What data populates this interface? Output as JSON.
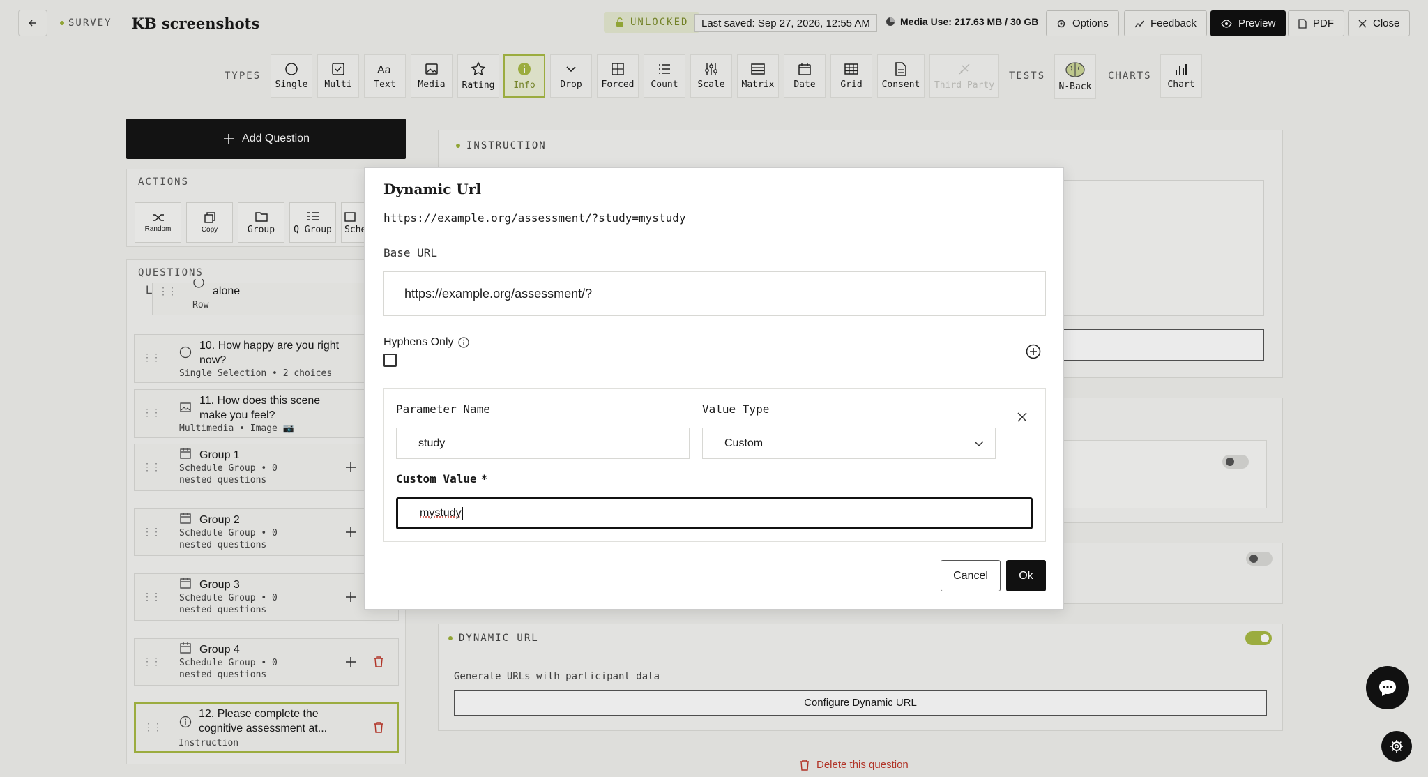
{
  "header": {
    "survey_tag": "SURVEY",
    "title": "KB screenshots",
    "unlocked": "UNLOCKED",
    "last_saved": "Last saved: Sep 27, 2026, 12:55 AM",
    "media_use": "Media Use: 217.63 MB / 30 GB",
    "options": "Options",
    "feedback": "Feedback",
    "preview": "Preview",
    "pdf": "PDF",
    "close": "Close"
  },
  "toolbar": {
    "types_label": "TYPES",
    "tests_label": "TESTS",
    "charts_label": "CHARTS",
    "types": [
      "Single",
      "Multi",
      "Text",
      "Media",
      "Rating",
      "Info",
      "Drop",
      "Forced",
      "Count",
      "Scale",
      "Matrix",
      "Date",
      "Grid",
      "Consent",
      "Third Party"
    ],
    "tests": [
      "N-Back"
    ],
    "charts": [
      "Chart"
    ]
  },
  "left": {
    "add_question": "Add Question",
    "actions_label": "ACTIONS",
    "actions": [
      "Random",
      "Copy",
      "Group",
      "Q Group",
      "Sche"
    ],
    "questions_label": "QUESTIONS",
    "partial_item": {
      "title": "alone",
      "sub": "Row"
    },
    "questions": [
      {
        "title": "10. How happy are you right now?",
        "sub": "Single Selection • 2 choices"
      },
      {
        "title": "11. How does this scene make you feel?",
        "sub": "Multimedia • Image 📷"
      },
      {
        "title": "Group 1",
        "sub": "Schedule Group • 0 nested questions"
      },
      {
        "title": "Group 2",
        "sub": "Schedule Group • 0 nested questions"
      },
      {
        "title": "Group 3",
        "sub": "Schedule Group • 0 nested questions"
      },
      {
        "title": "Group 4",
        "sub": "Schedule Group • 0 nested questions"
      },
      {
        "title": "12. Please complete the cognitive assessment at...",
        "sub": "Instruction"
      }
    ]
  },
  "right": {
    "instruction_label": "INSTRUCTION",
    "dynamic_url_label": "DYNAMIC URL",
    "dynamic_url_desc": "Generate URLs with participant data",
    "configure_button": "Configure Dynamic URL",
    "delete_question": "Delete this question"
  },
  "modal": {
    "title": "Dynamic Url",
    "preview_url": "https://example.org/assessment/?study=mystudy",
    "base_url_label": "Base URL",
    "base_url_value": "https://example.org/assessment/?",
    "hyphens_label": "Hyphens Only",
    "hyphens_checked": false,
    "param_name_label": "Parameter Name",
    "param_name_value": "study",
    "value_type_label": "Value Type",
    "value_type_value": "Custom",
    "custom_value_label": "Custom Value",
    "required_mark": "*",
    "custom_value_value": "mystudy",
    "cancel": "Cancel",
    "ok": "Ok"
  },
  "colors": {
    "accent": "#a9bb45",
    "dark": "#111111",
    "background": "#f1f1ee"
  }
}
